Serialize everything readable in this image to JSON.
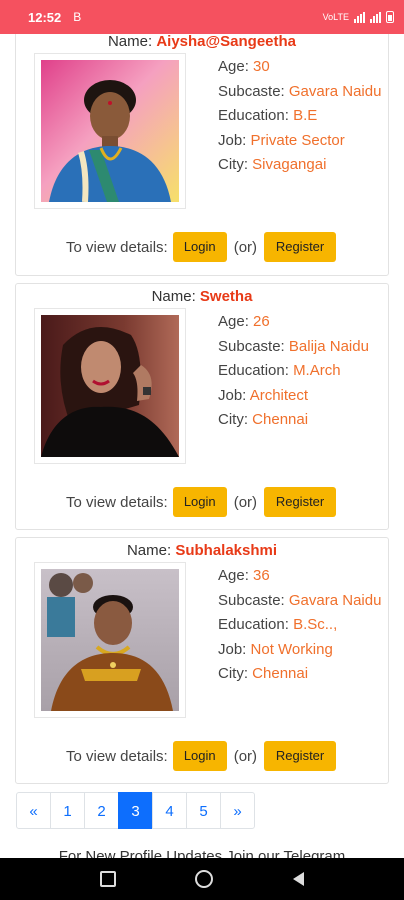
{
  "status_bar": {
    "time": "12:52",
    "indicator": "B",
    "network_label": "VoLTE",
    "colors": {
      "background": "#f5515f"
    }
  },
  "profiles": [
    {
      "name_label": "Name:",
      "name": "Aiysha@Sangeetha",
      "age_label": "Age:",
      "age": "30",
      "subcaste_label": "Subcaste:",
      "subcaste": "Gavara Naidu",
      "education_label": "Education:",
      "education": "B.E",
      "job_label": "Job:",
      "job": "Private Sector",
      "city_label": "City:",
      "city": "Sivagangai",
      "photo_icon": "profile-photo-woman-blue-saree"
    },
    {
      "name_label": "Name:",
      "name": "Swetha",
      "age_label": "Age:",
      "age": "26",
      "subcaste_label": "Subcaste:",
      "subcaste": "Balija Naidu",
      "education_label": "Education:",
      "education": "M.Arch",
      "job_label": "Job:",
      "job": "Architect",
      "city_label": "City:",
      "city": "Chennai",
      "photo_icon": "profile-photo-woman-dark-top"
    },
    {
      "name_label": "Name:",
      "name": "Subhalakshmi",
      "age_label": "Age:",
      "age": "36",
      "subcaste_label": "Subcaste:",
      "subcaste": "Gavara Naidu",
      "education_label": "Education:",
      "education": "B.Sc..,",
      "job_label": "Job:",
      "job": "Not Working",
      "city_label": "City:",
      "city": "Chennai",
      "photo_icon": "profile-photo-woman-brown-saree"
    }
  ],
  "details": {
    "prompt": "To view details:",
    "login": "Login",
    "or": "(or)",
    "register": "Register"
  },
  "pagination": {
    "prev": "«",
    "pages": [
      "1",
      "2",
      "3",
      "4",
      "5"
    ],
    "active_page": "3",
    "next": "»"
  },
  "footer": {
    "telegram_text": "For New Profile Updates Join our Telegram"
  },
  "colors": {
    "name_value": "#e83a17",
    "info_value": "#f0702c",
    "button": "#f7b500",
    "page_link": "#0d6efd"
  },
  "nav_bar": {
    "icons": [
      "recents-icon",
      "home-icon",
      "back-icon"
    ]
  }
}
